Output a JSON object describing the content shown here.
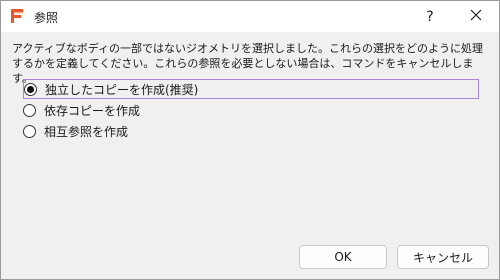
{
  "window": {
    "title": "参照",
    "help_label": "?",
    "icon": "fusion-app-icon",
    "close_icon": "close-icon"
  },
  "message": "アクティブなボディの一部ではないジオメトリを選択しました。これらの選択をどのように処理するかを定義してください。これらの参照を必要としない場合は、コマンドをキャンセルします。",
  "options": [
    {
      "label": "独立したコピーを作成(推奨)",
      "selected": true
    },
    {
      "label": "依存コピーを作成",
      "selected": false
    },
    {
      "label": "相互参照を作成",
      "selected": false
    }
  ],
  "buttons": {
    "ok": "OK",
    "cancel": "キャンセル"
  },
  "colors": {
    "brand_orange": "#e8572a",
    "focus_border": "#a684d6",
    "dialog_bg": "#f0f0f0"
  }
}
